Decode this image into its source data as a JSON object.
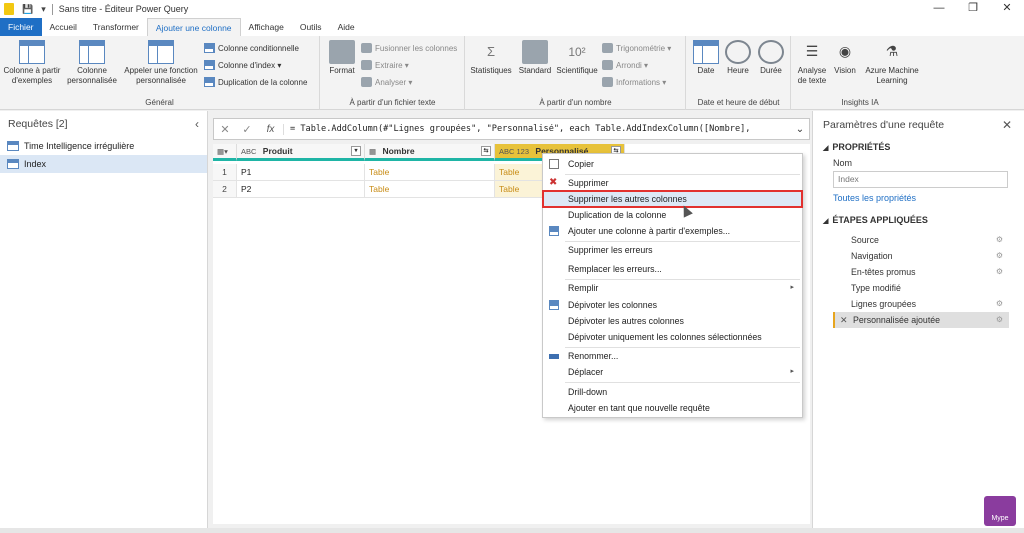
{
  "titlebar": {
    "title": "Sans titre - Éditeur Power Query",
    "qa_sep": "|"
  },
  "tabs": [
    {
      "label": "Fichier"
    },
    {
      "label": "Accueil"
    },
    {
      "label": "Transformer"
    },
    {
      "label": "Ajouter une colonne"
    },
    {
      "label": "Affichage"
    },
    {
      "label": "Outils"
    },
    {
      "label": "Aide"
    }
  ],
  "ribbon": {
    "general": {
      "label": "Général",
      "btn_exemples": "Colonne à partir d'exemples",
      "btn_perso": "Colonne personnalisée",
      "btn_fonction": "Appeler une fonction personnalisée",
      "btn_cond": "Colonne conditionnelle",
      "btn_index": "Colonne d'index",
      "btn_dup": "Duplication de la colonne"
    },
    "texte": {
      "label": "À partir d'un fichier texte",
      "btn_format": "Format",
      "btn_fusion": "Fusionner les colonnes",
      "btn_extraire": "Extraire",
      "btn_analyser": "Analyser"
    },
    "nombre": {
      "label": "À partir d'un nombre",
      "btn_stats": "Statistiques",
      "btn_standard": "Standard",
      "btn_sci": "Scientifique",
      "btn_trigo": "Trigonométrie",
      "btn_arrondi": "Arrondi",
      "btn_info": "Informations"
    },
    "date": {
      "label": "Date et heure de début",
      "btn_date": "Date",
      "btn_heure": "Heure",
      "btn_duree": "Durée"
    },
    "ia": {
      "label": "Insights IA",
      "btn_texte": "Analyse de texte",
      "btn_vision": "Vision",
      "btn_azure": "Azure Machine Learning"
    }
  },
  "queries": {
    "title": "Requêtes [2]",
    "items": [
      {
        "label": "Time Intelligence irrégulière"
      },
      {
        "label": "Index"
      }
    ]
  },
  "formula": {
    "fx": "fx",
    "text": "= Table.AddColumn(#\"Lignes groupées\", \"Personnalisé\", each Table.AddIndexColumn([Nombre],"
  },
  "grid": {
    "columns": [
      {
        "type": "ABC",
        "name": "Produit"
      },
      {
        "type": "",
        "name": "Nombre"
      },
      {
        "type": "ABC 123",
        "name": "Personnalisé"
      }
    ],
    "rows": [
      {
        "n": "1",
        "produit": "P1",
        "nombre": "Table",
        "perso": "Table"
      },
      {
        "n": "2",
        "produit": "P2",
        "nombre": "Table",
        "perso": "Table"
      }
    ]
  },
  "menu": {
    "items": [
      "Copier",
      "Supprimer",
      "Supprimer les autres colonnes",
      "Duplication de la colonne",
      "Ajouter une colonne à partir d'exemples...",
      "Supprimer les erreurs",
      "Remplacer les erreurs...",
      "Remplir",
      "Dépivoter les colonnes",
      "Dépivoter les autres colonnes",
      "Dépivoter uniquement les colonnes sélectionnées",
      "Renommer...",
      "Déplacer",
      "Drill-down",
      "Ajouter en tant que nouvelle requête"
    ],
    "highlight_color": "#e2312e"
  },
  "props": {
    "title": "Paramètres d'une requête",
    "sect_props": "PROPRIÉTÉS",
    "name_label": "Nom",
    "name_value": "Index",
    "all_props": "Toutes les propriétés",
    "sect_steps": "ÉTAPES APPLIQUÉES",
    "steps": [
      "Source",
      "Navigation",
      "En-têtes promus",
      "Type modifié",
      "Lignes groupées",
      "Personnalisée ajoutée"
    ]
  },
  "logo": {
    "text": "Mype"
  }
}
